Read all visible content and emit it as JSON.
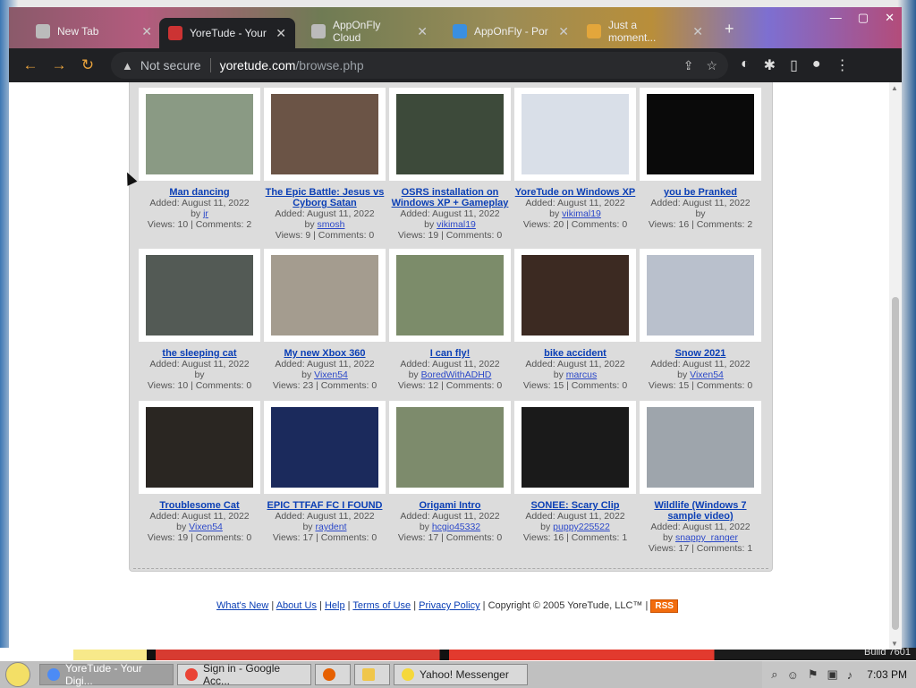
{
  "browser": {
    "tabs": [
      {
        "label": "New Tab",
        "active": false
      },
      {
        "label": "YoreTude - Your",
        "active": true
      },
      {
        "label": "AppOnFly Cloud",
        "active": false
      },
      {
        "label": "AppOnFly - Por",
        "active": false
      },
      {
        "label": "Just a moment...",
        "active": false
      }
    ],
    "not_secure": "Not secure",
    "url_host": "yoretude.com",
    "url_path": "/browse.php"
  },
  "videos": [
    {
      "title": "Man dancing",
      "added": "Added: August 11, 2022",
      "by": "by",
      "user": "jr",
      "stats": "Views: 10 | Comments: 2",
      "thumb": "#8a9a84"
    },
    {
      "title": "The Epic Battle: Jesus vs Cyborg Satan",
      "added": "Added: August 11, 2022",
      "by": "by",
      "user": "smosh",
      "stats": "Views: 9 | Comments: 0",
      "thumb": "#6b5446"
    },
    {
      "title": "OSRS installation on Windows XP + Gameplay",
      "added": "Added: August 11, 2022",
      "by": "by",
      "user": "vikimal19",
      "stats": "Views: 19 | Comments: 0",
      "thumb": "#3d4a3a"
    },
    {
      "title": "YoreTude on Windows XP",
      "added": "Added: August 11, 2022",
      "by": "by",
      "user": "vikimal19",
      "stats": "Views: 20 | Comments: 0",
      "thumb": "#d9dfe8"
    },
    {
      "title": "you be Pranked",
      "added": "Added: August 11, 2022",
      "by": "by",
      "user": "",
      "stats": "Views: 16 | Comments: 2",
      "thumb": "#0a0a0a"
    },
    {
      "title": "the sleeping cat",
      "added": "Added: August 11, 2022",
      "by": "by",
      "user": "",
      "stats": "Views: 10 | Comments: 0",
      "thumb": "#535a55"
    },
    {
      "title": "My new Xbox 360",
      "added": "Added: August 11, 2022",
      "by": "by",
      "user": "Vixen54",
      "stats": "Views: 23 | Comments: 0",
      "thumb": "#a49c8f"
    },
    {
      "title": "I can fly!",
      "added": "Added: August 11, 2022",
      "by": "by",
      "user": "BoredWithADHD",
      "stats": "Views: 12 | Comments: 0",
      "thumb": "#7c8c6a"
    },
    {
      "title": "bike accident",
      "added": "Added: August 11, 2022",
      "by": "by",
      "user": "marcus",
      "stats": "Views: 15 | Comments: 0",
      "thumb": "#3c2a22"
    },
    {
      "title": "Snow 2021",
      "added": "Added: August 11, 2022",
      "by": "by",
      "user": "Vixen54",
      "stats": "Views: 15 | Comments: 0",
      "thumb": "#b9c0cc"
    },
    {
      "title": "Troublesome Cat",
      "added": "Added: August 11, 2022",
      "by": "by",
      "user": "Vixen54",
      "stats": "Views: 19 | Comments: 0",
      "thumb": "#2a2622"
    },
    {
      "title": "EPIC TTFAF FC I FOUND",
      "added": "Added: August 11, 2022",
      "by": "by",
      "user": "raydent",
      "stats": "Views: 17 | Comments: 0",
      "thumb": "#1b2a5c"
    },
    {
      "title": "Origami Intro",
      "added": "Added: August 11, 2022",
      "by": "by",
      "user": "hcgio45332",
      "stats": "Views: 17 | Comments: 0",
      "thumb": "#7d8b6c"
    },
    {
      "title": "SONEE: Scary Clip",
      "added": "Added: August 11, 2022",
      "by": "by",
      "user": "puppy225522",
      "stats": "Views: 16 | Comments: 1",
      "thumb": "#1a1a1a"
    },
    {
      "title": "Wildlife (Windows 7 sample video)",
      "added": "Added: August 11, 2022",
      "by": "by",
      "user": "snappy_ranger",
      "stats": "Views: 17 | Comments: 1",
      "thumb": "#9ea5ac"
    }
  ],
  "footer": {
    "links": [
      "What's New",
      "About Us",
      "Help",
      "Terms of Use",
      "Privacy Policy"
    ],
    "copyright": "Copyright © 2005 YoreTude, LLC™",
    "rss": "RSS"
  },
  "desktop": {
    "build": "Build 7601"
  },
  "taskbar": {
    "buttons": [
      {
        "label": "YoreTude - Your Digi...",
        "active": true
      },
      {
        "label": "Sign in - Google Acc...",
        "active": false
      },
      {
        "label": "",
        "active": false
      },
      {
        "label": "",
        "active": false
      },
      {
        "label": "Yahoo! Messenger",
        "active": false
      }
    ],
    "clock": "7:03 PM"
  }
}
